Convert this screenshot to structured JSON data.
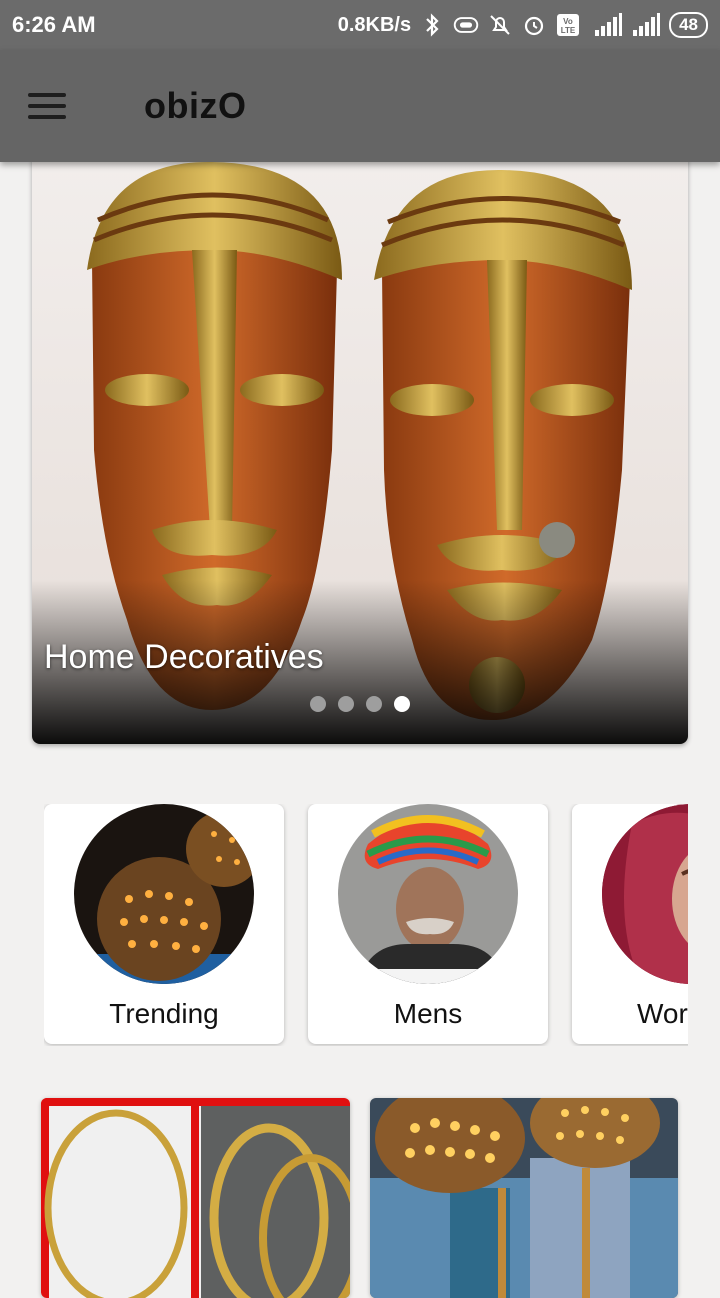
{
  "status_bar": {
    "time": "6:26 AM",
    "network_speed": "0.8KB/s",
    "battery": "48",
    "icons": [
      "bluetooth-icon",
      "vibrate-icon",
      "alarm-off-icon",
      "alarm-icon",
      "volte-icon",
      "signal-4g-icon",
      "signal-icon",
      "battery-icon"
    ]
  },
  "app_bar": {
    "title": "obizO",
    "menu_icon": "hamburger-menu-icon"
  },
  "banner": {
    "caption": "Home Decoratives",
    "slide_count": 4,
    "active_slide": 4
  },
  "categories": [
    {
      "label": "Trending"
    },
    {
      "label": "Mens"
    },
    {
      "label": "Wor"
    }
  ],
  "colors": {
    "app_bar": "#656565",
    "status_bar": "#6b6b6b",
    "background": "#f2f1f0"
  }
}
